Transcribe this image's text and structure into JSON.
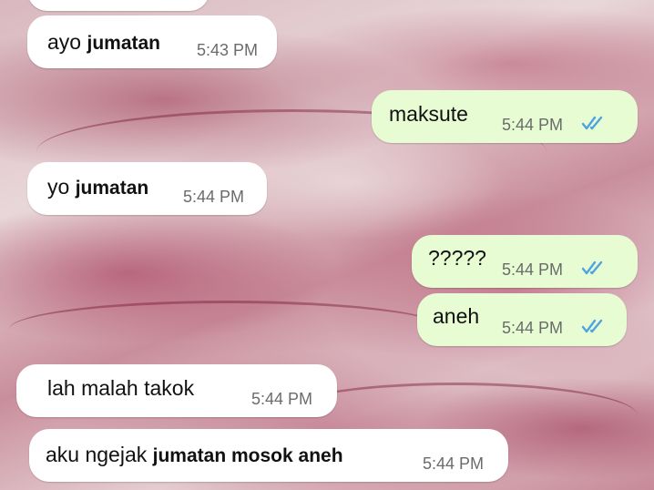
{
  "messages": [
    {
      "dir": "in",
      "text_plain": "ayo ",
      "text_strong": "jumatan",
      "time": "5:43 PM"
    },
    {
      "dir": "out",
      "text_plain": "maksute",
      "text_strong": "",
      "time": "5:44 PM",
      "read": true
    },
    {
      "dir": "in",
      "text_plain": "yo ",
      "text_strong": "jumatan",
      "time": "5:44 PM"
    },
    {
      "dir": "out",
      "text_plain": "?????",
      "text_strong": "",
      "time": "5:44 PM",
      "read": true
    },
    {
      "dir": "out",
      "text_plain": "aneh",
      "text_strong": "",
      "time": "5:44 PM",
      "read": true
    },
    {
      "dir": "in",
      "text_plain": "lah malah takok",
      "text_strong": "",
      "time": "5:44 PM"
    },
    {
      "dir": "in",
      "text_plain": "aku ngejak  ",
      "text_strong": "jumatan mosok aneh",
      "time": "5:44 PM"
    }
  ],
  "colors": {
    "incoming_bubble": "#ffffff",
    "outgoing_bubble": "#e7fcd3",
    "read_ticks": "#4fa3e0"
  },
  "icons": {
    "read_receipt": "double-check-icon"
  }
}
